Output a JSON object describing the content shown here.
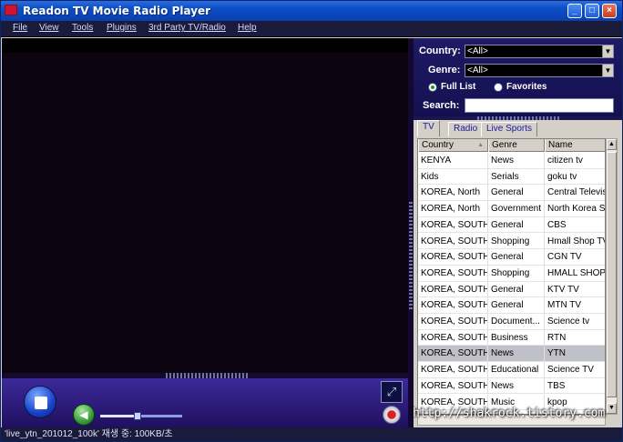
{
  "window": {
    "title": "Readon TV Movie Radio Player",
    "controls": {
      "minimize": "_",
      "maximize": "□",
      "close": "×"
    }
  },
  "menu": [
    "File",
    "View",
    "Tools",
    "Plugins",
    "3rd Party TV/Radio",
    "Help"
  ],
  "filters": {
    "country_label": "Country:",
    "country_value": "<All>",
    "genre_label": "Genre:",
    "genre_value": "<All>",
    "list_mode": {
      "full_list": "Full List",
      "favorites": "Favorites",
      "selected": "Full List"
    },
    "search_label": "Search:",
    "search_value": ""
  },
  "tabs": [
    "TV",
    "Radio",
    "Live Sports"
  ],
  "active_tab": "TV",
  "table": {
    "columns": [
      "Country",
      "Genre",
      "Name"
    ],
    "sorted_column": "Country",
    "rows": [
      [
        "KENYA",
        "News",
        "citizen tv"
      ],
      [
        "Kids",
        "Serials",
        "goku tv"
      ],
      [
        "KOREA, North",
        "General",
        "Central Televis"
      ],
      [
        "KOREA, North",
        "Government",
        "North Korea S"
      ],
      [
        "KOREA, SOUTH",
        "General",
        "CBS"
      ],
      [
        "KOREA, SOUTH",
        "Shopping",
        "Hmall Shop TV"
      ],
      [
        "KOREA, SOUTH",
        "General",
        "CGN TV"
      ],
      [
        "KOREA, SOUTH",
        "Shopping",
        "HMALL SHOP T"
      ],
      [
        "KOREA, SOUTH",
        "General",
        "KTV TV"
      ],
      [
        "KOREA, SOUTH",
        "General",
        "MTN TV"
      ],
      [
        "KOREA, SOUTH",
        "Document...",
        "Science tv"
      ],
      [
        "KOREA, SOUTH",
        "Business",
        "RTN"
      ],
      [
        "KOREA, SOUTH",
        "News",
        "YTN"
      ],
      [
        "KOREA, SOUTH",
        "Educational",
        "Science TV"
      ],
      [
        "KOREA, SOUTH",
        "News",
        "TBS"
      ],
      [
        "KOREA, SOUTH",
        "Music",
        "kpop"
      ]
    ],
    "selected_row": 12
  },
  "player": {
    "volume_level": 0.45
  },
  "status": "'live_ytn_201012_100k' 재생 중: 100KB/초",
  "watermark": "http://shakrock.tistory.com",
  "colors": {
    "titlebar": "#0a4ec4",
    "panel_bg": "#1a1650",
    "controls_bg": "#2a1a80",
    "selected_row": "#c0c0c8"
  }
}
